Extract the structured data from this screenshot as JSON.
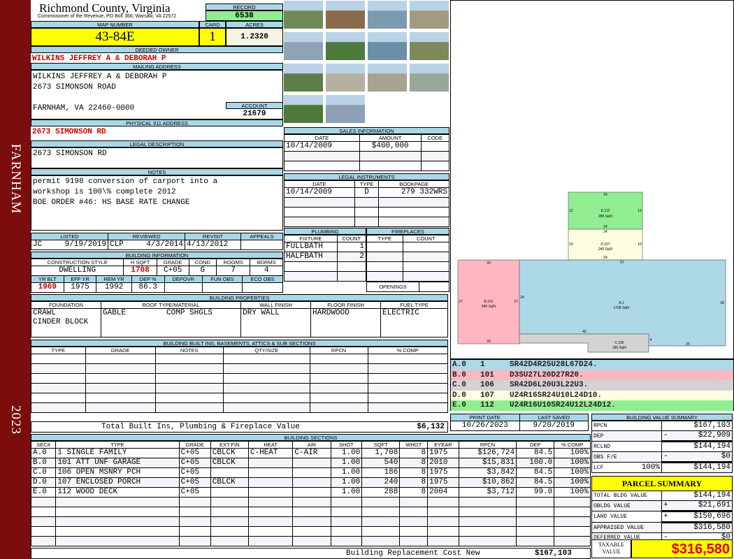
{
  "sidebar": {
    "city": "FARNHAM",
    "year": "2023"
  },
  "header": {
    "title": "Richmond County, Virginia",
    "subtitle": "Commissioner of the Revenue, PO Box 366, Warsaw, VA 22572",
    "record_label": "RECORD",
    "record": "6538"
  },
  "parcel": {
    "map_label": "MAP NUMBER",
    "map": "43-84E",
    "card_label": "CARD",
    "card": "1",
    "acres_label": "ACRES",
    "acres": "1.2320"
  },
  "owner": {
    "label": "DEEDED OWNER",
    "name": "WILKINS JEFFREY A & DEBORAH P"
  },
  "mailing": {
    "label": "MAILING ADDRESS",
    "line1": "WILKINS JEFFREY A & DEBORAH P",
    "line2": "2673 SIMONSON ROAD",
    "line3": "FARNHAM, VA 22460-0000",
    "account_label": "ACCOUNT",
    "account": "21679"
  },
  "physical": {
    "label": "PHYSICAL 911 ADDRESS",
    "value": "2673 SIMONSON RD"
  },
  "legal": {
    "label": "LEGAL DESCRIPTION",
    "value": "2673 SIMONSON RD"
  },
  "notes": {
    "label": "NOTES",
    "lines": [
      "permit 9198 conversion of carport into a",
      "workshop is 100\\% complete 2012",
      "BOE ORDER #46: HS BASE RATE CHANGE"
    ]
  },
  "review": {
    "listed_label": "LISTED",
    "listed_by": "JC",
    "listed": "9/19/2019",
    "reviewed_label": "REVIEWED",
    "reviewed_by": "CLP",
    "reviewed": "4/3/2014",
    "revisit_label": "REVISIT",
    "revisit": "4/13/2012",
    "appeals_label": "APPEALS",
    "appeals": ""
  },
  "building_info": {
    "label": "BUILDING INFORMATION",
    "row1_headers": [
      "CONSTRUCTION STYLE",
      "H SQFT",
      "GRADE",
      "COND",
      "ROOMS",
      "BDRMS"
    ],
    "row1_values": [
      "DWELLING",
      "1708",
      "C+05",
      "G",
      "7",
      "4"
    ],
    "row2_headers": [
      "YR BLT",
      "EFF YR",
      "REM YR",
      "DEP %",
      "DEPOVR",
      "FUN OBS",
      "ECO OBS"
    ],
    "row2_values": [
      "1969",
      "1975",
      "1992",
      "86.3",
      "",
      "",
      ""
    ]
  },
  "properties": {
    "label": "BUILDING PROPERTIES",
    "headers": [
      "FOUNDATION",
      "ROOF TYPE/MATERIAL",
      "WALL FINISH",
      "FLOOR FINISH",
      "FUEL TYPE"
    ],
    "foundation": [
      "CRAWL",
      "CINDER BLOCK"
    ],
    "roof_type": "GABLE",
    "roof_material": "COMP SHGLS",
    "wall": "DRY WALL",
    "floor": "HARDWOOD",
    "fuel": "ELECTRIC"
  },
  "builtins": {
    "label": "BUILDING BUILT INS, BASEMENTS, ATTICS & SUB SECTIONS",
    "headers": [
      "TYPE",
      "GRADE",
      "NOTES",
      "QTY/SIZE",
      "RPCN",
      "% COMP"
    ],
    "total_label": "Total Built Ins, Plumbing & Fireplace Value",
    "total": "$6,132"
  },
  "sales": {
    "label": "SALES INFORMATION",
    "headers": [
      "DATE",
      "AMOUNT",
      "CODE"
    ],
    "rows": [
      [
        "10/14/2009",
        "$400,000",
        ""
      ]
    ]
  },
  "instruments": {
    "label": "LEGAL INSTRUMENTS",
    "headers": [
      "DATE",
      "TYPE",
      "BOOKPAGE"
    ],
    "rows": [
      [
        "10/14/2009",
        "D",
        "279 332WRS"
      ]
    ]
  },
  "plumbing": {
    "label": "PLUMBING",
    "headers": [
      "FIXTURE",
      "COUNT"
    ],
    "rows": [
      [
        "FULLBATH",
        "1"
      ],
      [
        "HALFBATH",
        "2"
      ]
    ]
  },
  "fireplaces": {
    "label": "FIREPLACES",
    "headers": [
      "TYPE",
      "COUNT"
    ],
    "openings_label": "OPENINGS"
  },
  "sketch": {
    "labels": {
      "a": "A.1",
      "a_area": "1708 SqFt",
      "b": "B.101",
      "b_area": "540 SqFt",
      "c": "C.106",
      "c_area": "186 SqFt",
      "d": "D.107",
      "d_area": "240 SqFt",
      "e": "E.112",
      "e_area": "288 SqFt"
    },
    "dims": {
      "a_top": "67",
      "a_right": "28",
      "a_bottom": "25",
      "a_left": "24",
      "a_inner": "42",
      "a_step": "4",
      "b_top": "20",
      "b_bottom": "20",
      "b_left": "27",
      "b_right": "27",
      "d_top": "24",
      "d_bottom": "24",
      "d_left": "10",
      "d_right": "10",
      "e_top": "24",
      "e_bottom": "24",
      "e_left": "12",
      "e_right": "12"
    },
    "codes": [
      {
        "sec": "A.0",
        "code": "1",
        "path": "SR42D4R25U28L67D24.",
        "color": "#add8e6"
      },
      {
        "sec": "B.0",
        "code": "101",
        "path": "D3SU27L20D27R20.",
        "color": "#ffb6c1"
      },
      {
        "sec": "C.0",
        "code": "106",
        "path": "SR42D6L20U3L22U3.",
        "color": "#d3d3d3"
      },
      {
        "sec": "D.0",
        "code": "107",
        "path": "U24R16SR24U10L24D10.",
        "color": "#fffde0"
      },
      {
        "sec": "E.0",
        "code": "112",
        "path": "U24R16U10SR24U12L24D12.",
        "color": "#90ee90"
      }
    ]
  },
  "dates": {
    "print_label": "PRINT DATE",
    "print": "10/26/2023",
    "saved_label": "LAST SAVED",
    "saved": "9/20/2019"
  },
  "sections": {
    "label": "BUILDING SECTIONS",
    "headers": [
      "SEC#",
      "TYPE",
      "GRADE",
      "EXT FIN",
      "HEAT",
      "AIR",
      "SHGT",
      "SQFT",
      "WHGT",
      "EYEAR",
      "RPCN",
      "DEP",
      "% COMP"
    ],
    "rows": [
      [
        "A.0",
        "  1 SINGLE FAMILY",
        "C+05",
        "CBLCK",
        "C-HEAT",
        "C-AIR",
        "1.00",
        "1,708",
        "8",
        "1975",
        "$126,724",
        "84.5",
        "100%"
      ],
      [
        "B.0",
        "101 ATT UNF GARAGE",
        "C+05",
        "CBLCK",
        "",
        "",
        "1.00",
        "540",
        "8",
        "2010",
        "$15,831",
        "100.0",
        "100%"
      ],
      [
        "C.0",
        "106 OPEN MSNRY PCH",
        "C+05",
        "",
        "",
        "",
        "1.00",
        "186",
        "8",
        "1975",
        "$3,842",
        "84.5",
        "100%"
      ],
      [
        "D.0",
        "107 ENCLOSED PORCH",
        "C+05",
        "CBLCK",
        "",
        "",
        "1.00",
        "240",
        "8",
        "1975",
        "$10,862",
        "84.5",
        "100%"
      ],
      [
        "E.0",
        "112 WOOD DECK",
        "C+05",
        "",
        "",
        "",
        "1.00",
        "288",
        "8",
        "2004",
        "$3,712",
        "99.0",
        "100%"
      ]
    ],
    "total_label": "Building Replacement Cost New",
    "total": "$167,103"
  },
  "value_summary": {
    "label": "BUILDING VALUE SUMMARY",
    "rows": [
      {
        "label": "RPCN",
        "sign": "",
        "value": "$167,103"
      },
      {
        "label": "DEP",
        "sign": "-",
        "value": "$22,909"
      },
      {
        "label": "RCLND",
        "sign": "",
        "value": "$144,194"
      },
      {
        "label": "OBS F/E",
        "sign": "-",
        "value": "$0"
      },
      {
        "label": "LCF",
        "pct": "100%",
        "sign": "",
        "value": "$144,194"
      }
    ]
  },
  "parcel_summary": {
    "title": "PARCEL SUMMARY",
    "rows": [
      {
        "label": "TOTAL BLDG VALUE",
        "sign": "",
        "value": "$144,194"
      },
      {
        "label": "OBLDG VALUE",
        "sign": "+",
        "value": "$21,691"
      },
      {
        "label": "LAND VALUE",
        "sign": "+",
        "value": "$150,696"
      },
      {
        "label": "APPRAISED VALUE",
        "sign": "",
        "value": "$316,580"
      },
      {
        "label": "DEFERRED VALUE",
        "sign": "-",
        "value": "$0"
      }
    ],
    "taxable_label": "TAXABLE VALUE",
    "taxable": "$316,580"
  },
  "colors": {
    "sidebar": "#7b0d0d",
    "label_bg": "#a9d7e6",
    "highlight": "#ffff00",
    "record_bg": "#90ee90"
  }
}
